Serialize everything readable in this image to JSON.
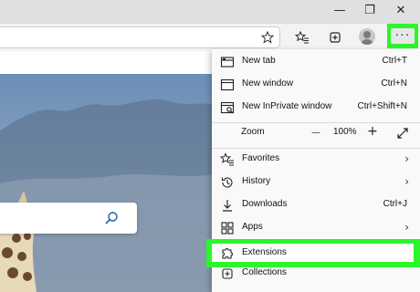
{
  "menu": {
    "new_tab": {
      "label": "New tab",
      "shortcut": "Ctrl+T"
    },
    "new_window": {
      "label": "New window",
      "shortcut": "Ctrl+N"
    },
    "inprivate": {
      "label": "New InPrivate window",
      "shortcut": "Ctrl+Shift+N"
    },
    "zoom": {
      "label": "Zoom",
      "minus": "—",
      "value": "100%",
      "plus": "+"
    },
    "favorites": {
      "label": "Favorites"
    },
    "history": {
      "label": "History"
    },
    "downloads": {
      "label": "Downloads",
      "shortcut": "Ctrl+J"
    },
    "apps": {
      "label": "Apps"
    },
    "extensions": {
      "label": "Extensions"
    },
    "collections": {
      "label": "Collections"
    }
  },
  "window": {
    "minimize": "—",
    "restore": "❐",
    "close": "✕"
  },
  "toolbar": {
    "more": "···"
  },
  "colors": {
    "highlight": "#2cf52c"
  }
}
